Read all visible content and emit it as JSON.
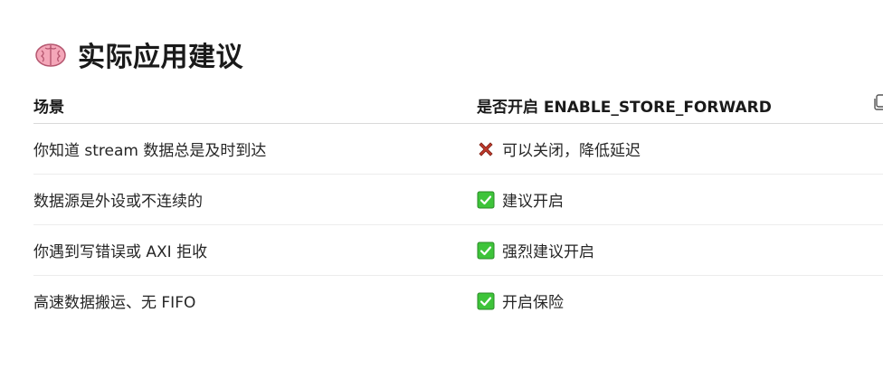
{
  "section": {
    "icon": "brain-icon",
    "title": "实际应用建议"
  },
  "table": {
    "headers": {
      "scene": "场景",
      "enable": "是否开启 ENABLE_STORE_FORWARD"
    },
    "header_action_icon": "copy-icon",
    "rows": [
      {
        "scene": "你知道 stream 数据总是及时到达",
        "status_icon": "cross-mark-icon",
        "advice": "可以关闭，降低延迟"
      },
      {
        "scene": "数据源是外设或不连续的",
        "status_icon": "check-mark-icon",
        "advice": "建议开启"
      },
      {
        "scene": "你遇到写错误或 AXI 拒收",
        "status_icon": "check-mark-icon",
        "advice": "强烈建议开启"
      },
      {
        "scene": "高速数据搬运、无 FIFO",
        "status_icon": "check-mark-icon",
        "advice": "开启保险"
      }
    ]
  },
  "colors": {
    "check_green": "#3ec43a",
    "cross_red": "#c0392b",
    "brain_pink": "#f4a7b9"
  }
}
